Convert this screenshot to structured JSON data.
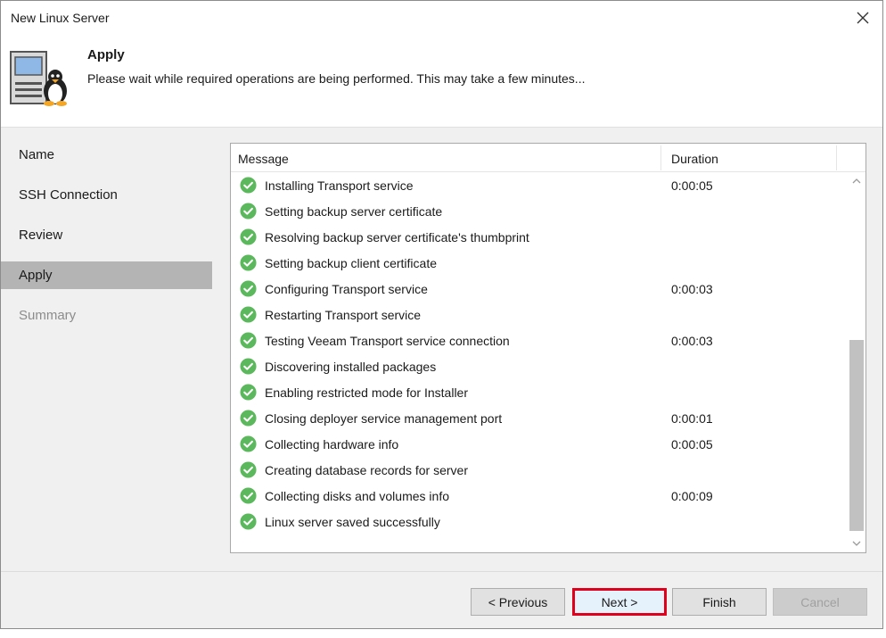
{
  "window": {
    "title": "New Linux Server"
  },
  "header": {
    "title": "Apply",
    "description": "Please wait while required operations are being performed. This may take a few minutes..."
  },
  "sidebar": {
    "items": [
      {
        "label": "Name",
        "state": "normal"
      },
      {
        "label": "SSH Connection",
        "state": "normal"
      },
      {
        "label": "Review",
        "state": "normal"
      },
      {
        "label": "Apply",
        "state": "active"
      },
      {
        "label": "Summary",
        "state": "disabled"
      }
    ]
  },
  "log": {
    "columns": {
      "message": "Message",
      "duration": "Duration"
    },
    "rows": [
      {
        "message": "Installing Transport service",
        "duration": "0:00:05",
        "status": "success"
      },
      {
        "message": "Setting backup server certificate",
        "duration": "",
        "status": "success"
      },
      {
        "message": "Resolving backup server certificate's thumbprint",
        "duration": "",
        "status": "success"
      },
      {
        "message": "Setting backup client certificate",
        "duration": "",
        "status": "success"
      },
      {
        "message": "Configuring Transport service",
        "duration": "0:00:03",
        "status": "success"
      },
      {
        "message": "Restarting Transport service",
        "duration": "",
        "status": "success"
      },
      {
        "message": "Testing Veeam Transport service connection",
        "duration": "0:00:03",
        "status": "success"
      },
      {
        "message": "Discovering installed packages",
        "duration": "",
        "status": "success"
      },
      {
        "message": "Enabling restricted mode for Installer",
        "duration": "",
        "status": "success"
      },
      {
        "message": "Closing deployer service management port",
        "duration": "0:00:01",
        "status": "success"
      },
      {
        "message": "Collecting hardware info",
        "duration": "0:00:05",
        "status": "success"
      },
      {
        "message": "Creating database records for server",
        "duration": "",
        "status": "success"
      },
      {
        "message": "Collecting disks and volumes info",
        "duration": "0:00:09",
        "status": "success"
      },
      {
        "message": "Linux server saved successfully",
        "duration": "",
        "status": "success"
      }
    ]
  },
  "buttons": {
    "previous": "< Previous",
    "next": "Next >",
    "finish": "Finish",
    "cancel": "Cancel"
  },
  "colors": {
    "success": "#5cb85c",
    "highlight": "#e0001b",
    "active_nav": "#b4b4b4"
  },
  "icons": {
    "close": "close-icon",
    "header": "linux-server-icon",
    "status": "success-check-icon"
  }
}
